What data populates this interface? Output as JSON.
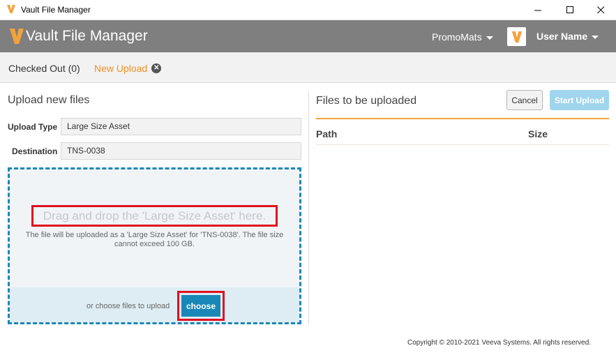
{
  "window": {
    "title": "Vault File Manager"
  },
  "header": {
    "app_title": "Vault File Manager",
    "vault_name": "PromoMats",
    "user_name": "User Name",
    "brand_color": "#f5a23c"
  },
  "tabs": {
    "checked_out": "Checked Out (0)",
    "new_upload": "New Upload"
  },
  "upload_form": {
    "title": "Upload new files",
    "upload_type_label": "Upload Type",
    "upload_type_value": "Large Size Asset",
    "destination_label": "Destination",
    "destination_value": "TNS-0038"
  },
  "dropzone": {
    "drag_text": "Drag and drop the 'Large Size Asset' here.",
    "info_text": "The file will be uploaded as a 'Large Size Asset' for 'TNS-0038'. The file size cannot exceed 100 GB.",
    "or_text": "or choose files to upload",
    "choose_label": "choose"
  },
  "files_panel": {
    "title": "Files to be uploaded",
    "cancel_label": "Cancel",
    "start_label": "Start Upload",
    "columns": [
      "Path",
      "Size"
    ]
  },
  "footer": {
    "copyright": "Copyright © 2010-2021 Veeva Systems. All rights reserved."
  }
}
